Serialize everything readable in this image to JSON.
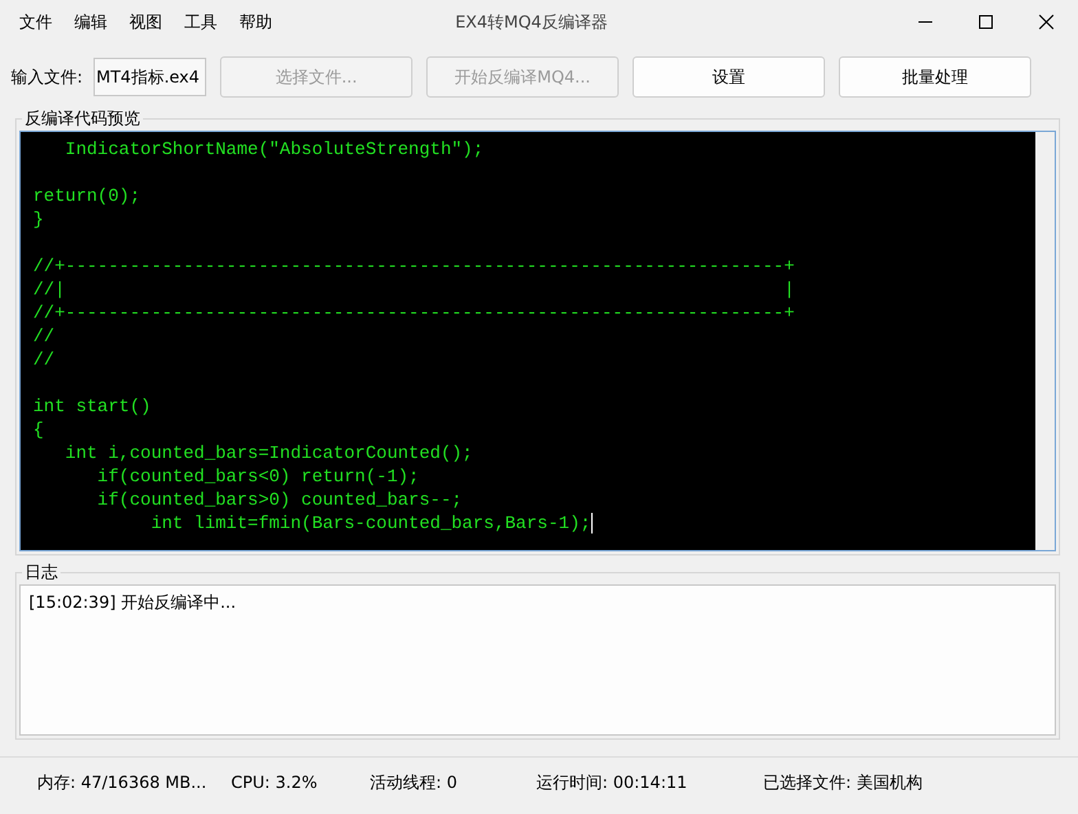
{
  "window": {
    "title": "EX4转MQ4反编译器"
  },
  "menu": [
    "文件",
    "编辑",
    "视图",
    "工具",
    "帮助"
  ],
  "toolbar": {
    "input_label": "输入文件:",
    "input_value": "MT4指标.ex4",
    "buttons": [
      {
        "label": "选择文件...",
        "disabled": true
      },
      {
        "label": "开始反编译MQ4...",
        "disabled": true
      },
      {
        "label": "设置",
        "disabled": false
      },
      {
        "label": "批量处理",
        "disabled": false
      }
    ]
  },
  "code_preview": {
    "title": "反编译代码预览",
    "blocks": [
      [
        "   IndicatorShortName(\"AbsoluteStrength\");"
      ],
      [
        "return(0);",
        "}"
      ],
      [
        "//+-------------------------------------------------------------------+",
        "//|                                                                   |",
        "//+-------------------------------------------------------------------+",
        "//",
        "//"
      ],
      [
        "int start()",
        "{",
        "   int i,counted_bars=IndicatorCounted();",
        "      if(counted_bars<0) return(-1);",
        "      if(counted_bars>0) counted_bars--;",
        "           int limit=fmin(Bars-counted_bars,Bars-1);"
      ]
    ]
  },
  "log": {
    "title": "日志",
    "entries": [
      "[15:02:39] 开始反编译中..."
    ]
  },
  "status_bar": [
    "内存: 47/16368 MB...",
    "CPU: 3.2%",
    "活动线程: 0",
    "运行时间: 00:14:11",
    "已选择文件: 美国机构"
  ]
}
